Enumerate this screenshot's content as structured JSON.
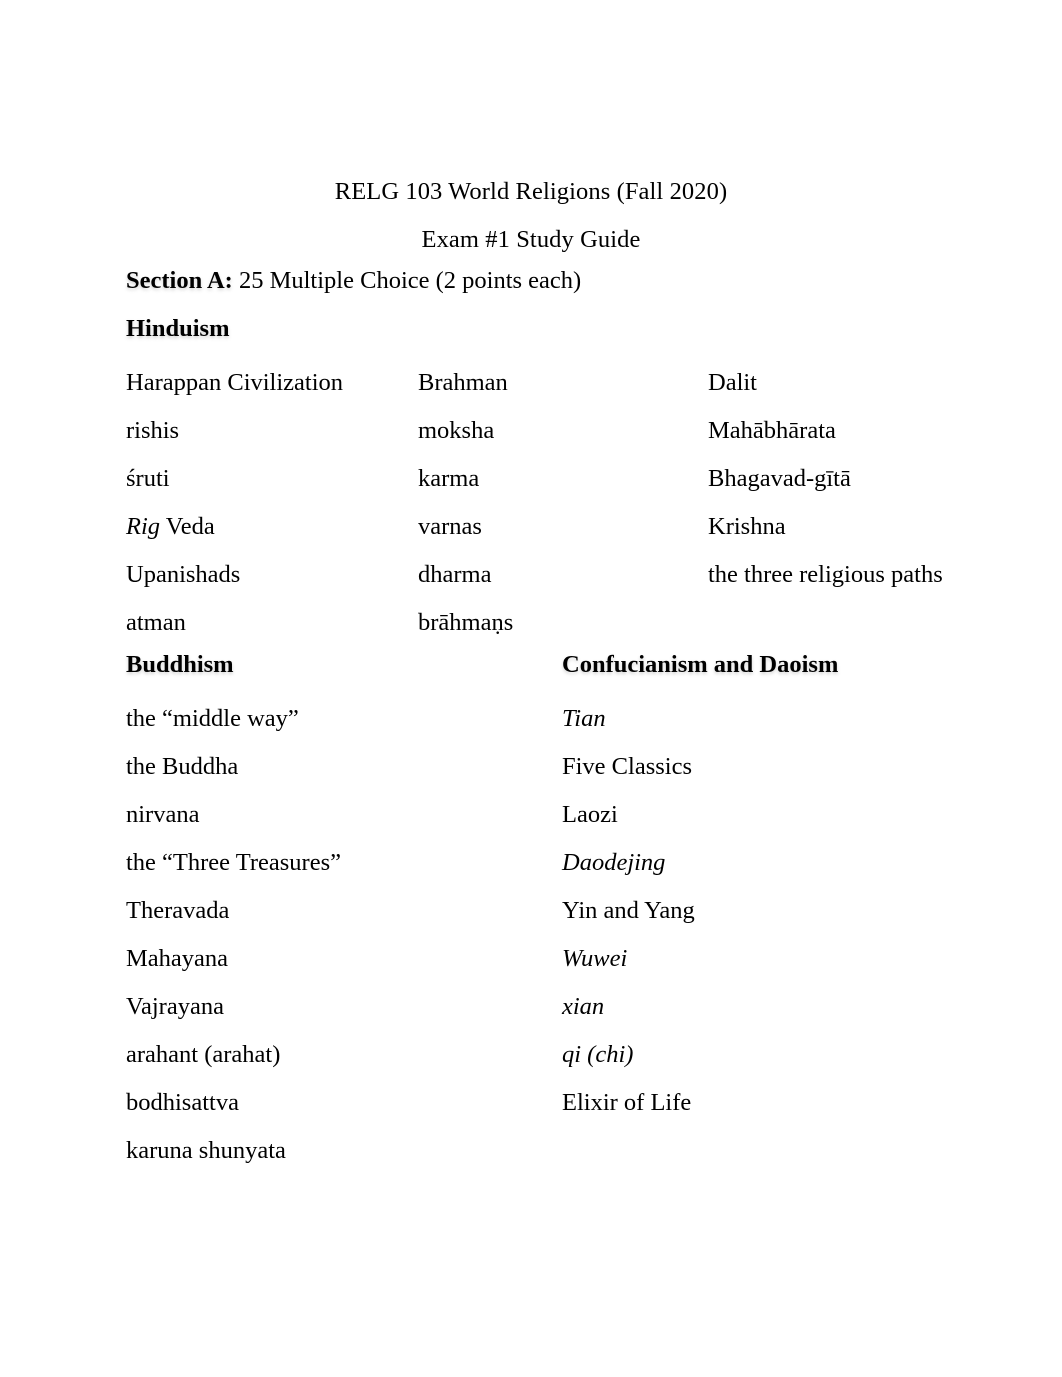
{
  "document": {
    "title": "RELG 103 World Religions (Fall 2020)",
    "subtitle": "Exam #1 Study Guide"
  },
  "section_a": {
    "lead": "Section A:",
    "description": " 25 Multiple Choice (2 points each)"
  },
  "hinduism": {
    "heading": "Hinduism",
    "column_1": [
      "Harappan Civilization",
      "rishis",
      "śruti",
      "Rig Veda",
      "Upanishads",
      "atman"
    ],
    "column_1_italic_prefix": "Rig",
    "column_1_italic_suffix": " Veda",
    "column_2": [
      "Brahman",
      "moksha",
      "karma",
      "varnas",
      "dharma",
      "brāhmaṇs"
    ],
    "column_3": [
      "Dalit",
      "Mahābhārata",
      "Bhagavad-gītā",
      "Krishna",
      "the three religious paths"
    ]
  },
  "buddhism": {
    "heading": "Buddhism",
    "terms": [
      "the “middle way”",
      "the Buddha",
      "nirvana",
      "the “Three Treasures”",
      "Theravada",
      "Mahayana",
      "Vajrayana",
      "arahant (arahat)",
      "bodhisattva",
      "karuna shunyata"
    ]
  },
  "confucianism_daoism": {
    "heading": "Confucianism and Daoism",
    "terms": [
      {
        "text": "Tian",
        "italic": true
      },
      {
        "text": "Five Classics",
        "italic": false
      },
      {
        "text": "Laozi",
        "italic": false
      },
      {
        "text": "Daodejing",
        "italic": true
      },
      {
        "text": "Yin and Yang",
        "italic": false
      },
      {
        "text": "Wuwei",
        "italic": true
      },
      {
        "text": "xian",
        "italic": true
      },
      {
        "text": "qi (chi)",
        "italic": true
      },
      {
        "text": "Elixir of Life",
        "italic": false
      }
    ]
  }
}
